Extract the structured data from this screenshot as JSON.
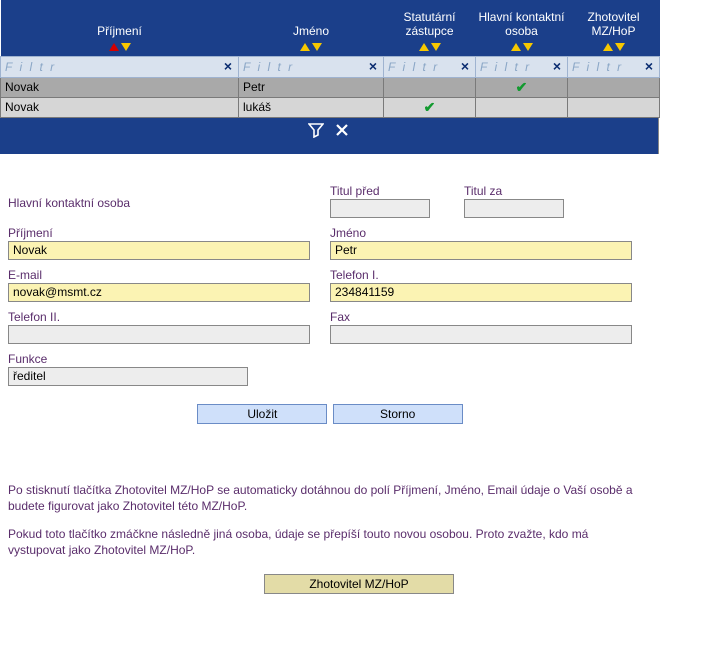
{
  "grid": {
    "columns": [
      {
        "label": "Příjmení",
        "sort": "active"
      },
      {
        "label": "Jméno",
        "sort": "normal"
      },
      {
        "label": "Statutární zástupce",
        "sort": "normal"
      },
      {
        "label": "Hlavní kontaktní osoba",
        "sort": "normal"
      },
      {
        "label": "Zhotovitel MZ/HoP",
        "sort": "normal"
      }
    ],
    "filter_placeholder": "F i l t r",
    "rows": [
      {
        "prijmeni": "Novak",
        "jmeno": "Petr",
        "stat": "",
        "hko": "✔",
        "zhot": "",
        "selected": true
      },
      {
        "prijmeni": "Novak",
        "jmeno": "lukáš",
        "stat": "✔",
        "hko": "",
        "zhot": "",
        "selected": false
      }
    ]
  },
  "form": {
    "section_title": "Hlavní kontaktní osoba",
    "titul_pred": {
      "label": "Titul před",
      "value": ""
    },
    "titul_za": {
      "label": "Titul za",
      "value": ""
    },
    "prijmeni": {
      "label": "Příjmení",
      "value": "Novak"
    },
    "jmeno": {
      "label": "Jméno",
      "value": "Petr"
    },
    "email": {
      "label": "E-mail",
      "value": "novak@msmt.cz"
    },
    "tel1": {
      "label": "Telefon I.",
      "value": "234841159"
    },
    "tel2": {
      "label": "Telefon II.",
      "value": ""
    },
    "fax": {
      "label": "Fax",
      "value": ""
    },
    "funkce": {
      "label": "Funkce",
      "value": "ředitel"
    },
    "save_label": "Uložit",
    "cancel_label": "Storno"
  },
  "info": {
    "p1": "Po stisknutí tlačítka Zhotovitel MZ/HoP se automaticky dotáhnou do polí Příjmení, Jméno, Email údaje o Vaší osobě a budete figurovat jako Zhotovitel této MZ/HoP.",
    "p2": "Pokud toto tlačítko zmáčkne následně jiná osoba, údaje se přepíší touto novou osobou. Proto zvažte, kdo má vystupovat jako Zhotovitel MZ/HoP.",
    "button_label": "Zhotovitel MZ/HoP"
  }
}
